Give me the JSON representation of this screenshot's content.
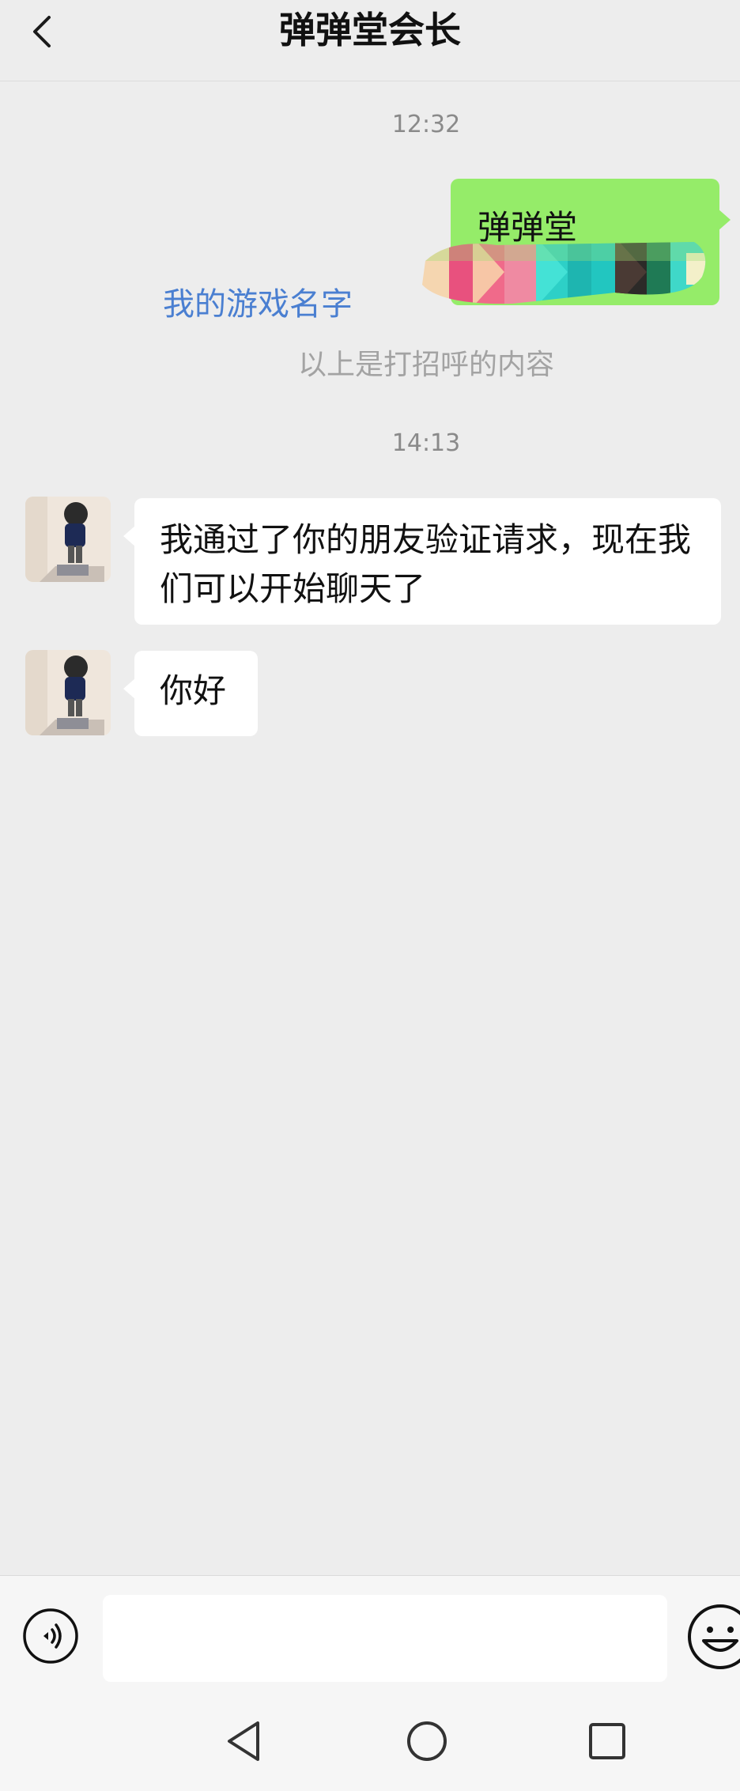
{
  "header": {
    "title": "弹弹堂会长",
    "back_icon": "chevron-left-icon"
  },
  "chat": {
    "timestamp_1": "12:32",
    "outgoing": {
      "text": "弹弹堂",
      "bubble_color": "#95ec69"
    },
    "game_name_link": "我的游戏名字",
    "link_color": "#4a7fd1",
    "system_note": "以上是打招呼的内容",
    "timestamp_2": "14:13",
    "incoming": [
      {
        "text": "我通过了你的朋友验证请求，现在我们可以开始聊天了"
      },
      {
        "text": "你好"
      }
    ]
  },
  "input_bar": {
    "voice_icon": "voice-icon",
    "input_value": "",
    "emoji_icon": "emoji-icon"
  },
  "nav": {
    "back_icon": "nav-back-icon",
    "home_icon": "nav-home-icon",
    "recents_icon": "nav-recents-icon"
  }
}
